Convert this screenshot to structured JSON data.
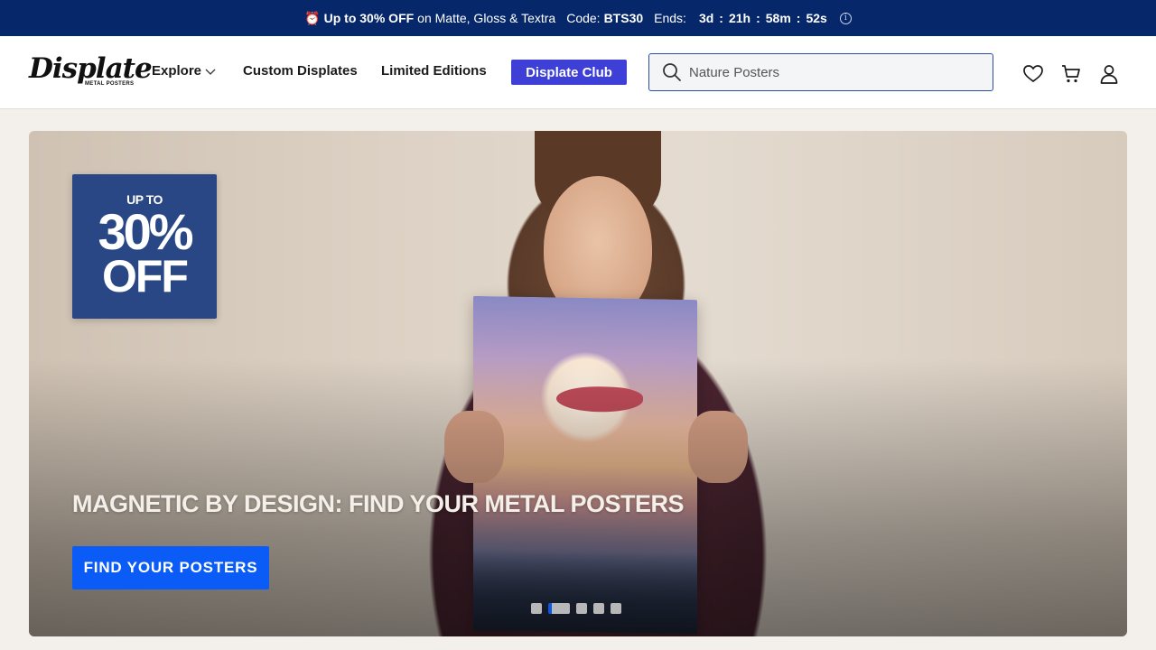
{
  "promo": {
    "icon": "alarm-clock-icon",
    "highlight": "Up to 30% OFF",
    "rest": "on Matte, Gloss & Textra",
    "code_label": "Code:",
    "code": "BTS30",
    "ends_label": "Ends:",
    "days": "3d",
    "hours": "21h",
    "minutes": "58m",
    "seconds": "52s",
    "separator": ":",
    "info_icon": "info-icon"
  },
  "header": {
    "logo_text": "Displate",
    "logo_sub": "METAL POSTERS",
    "nav": {
      "explore": "Explore",
      "custom": "Custom Displates",
      "limited": "Limited Editions"
    },
    "club_button": "Displate Club",
    "search_placeholder": "Nature Posters",
    "icons": [
      "heart-icon",
      "cart-icon",
      "user-icon"
    ]
  },
  "hero": {
    "badge": {
      "line1": "UP TO",
      "line2": "30%",
      "line3": "OFF"
    },
    "title": "MAGNETIC BY DESIGN: FIND YOUR METAL POSTERS",
    "cta": "FIND YOUR POSTERS",
    "slides_total": 5,
    "active_slide": 2
  },
  "colors": {
    "promo_bg": "#06286b",
    "club": "#3d3fd6",
    "cta": "#0b5cf6",
    "badge": "#294785"
  }
}
